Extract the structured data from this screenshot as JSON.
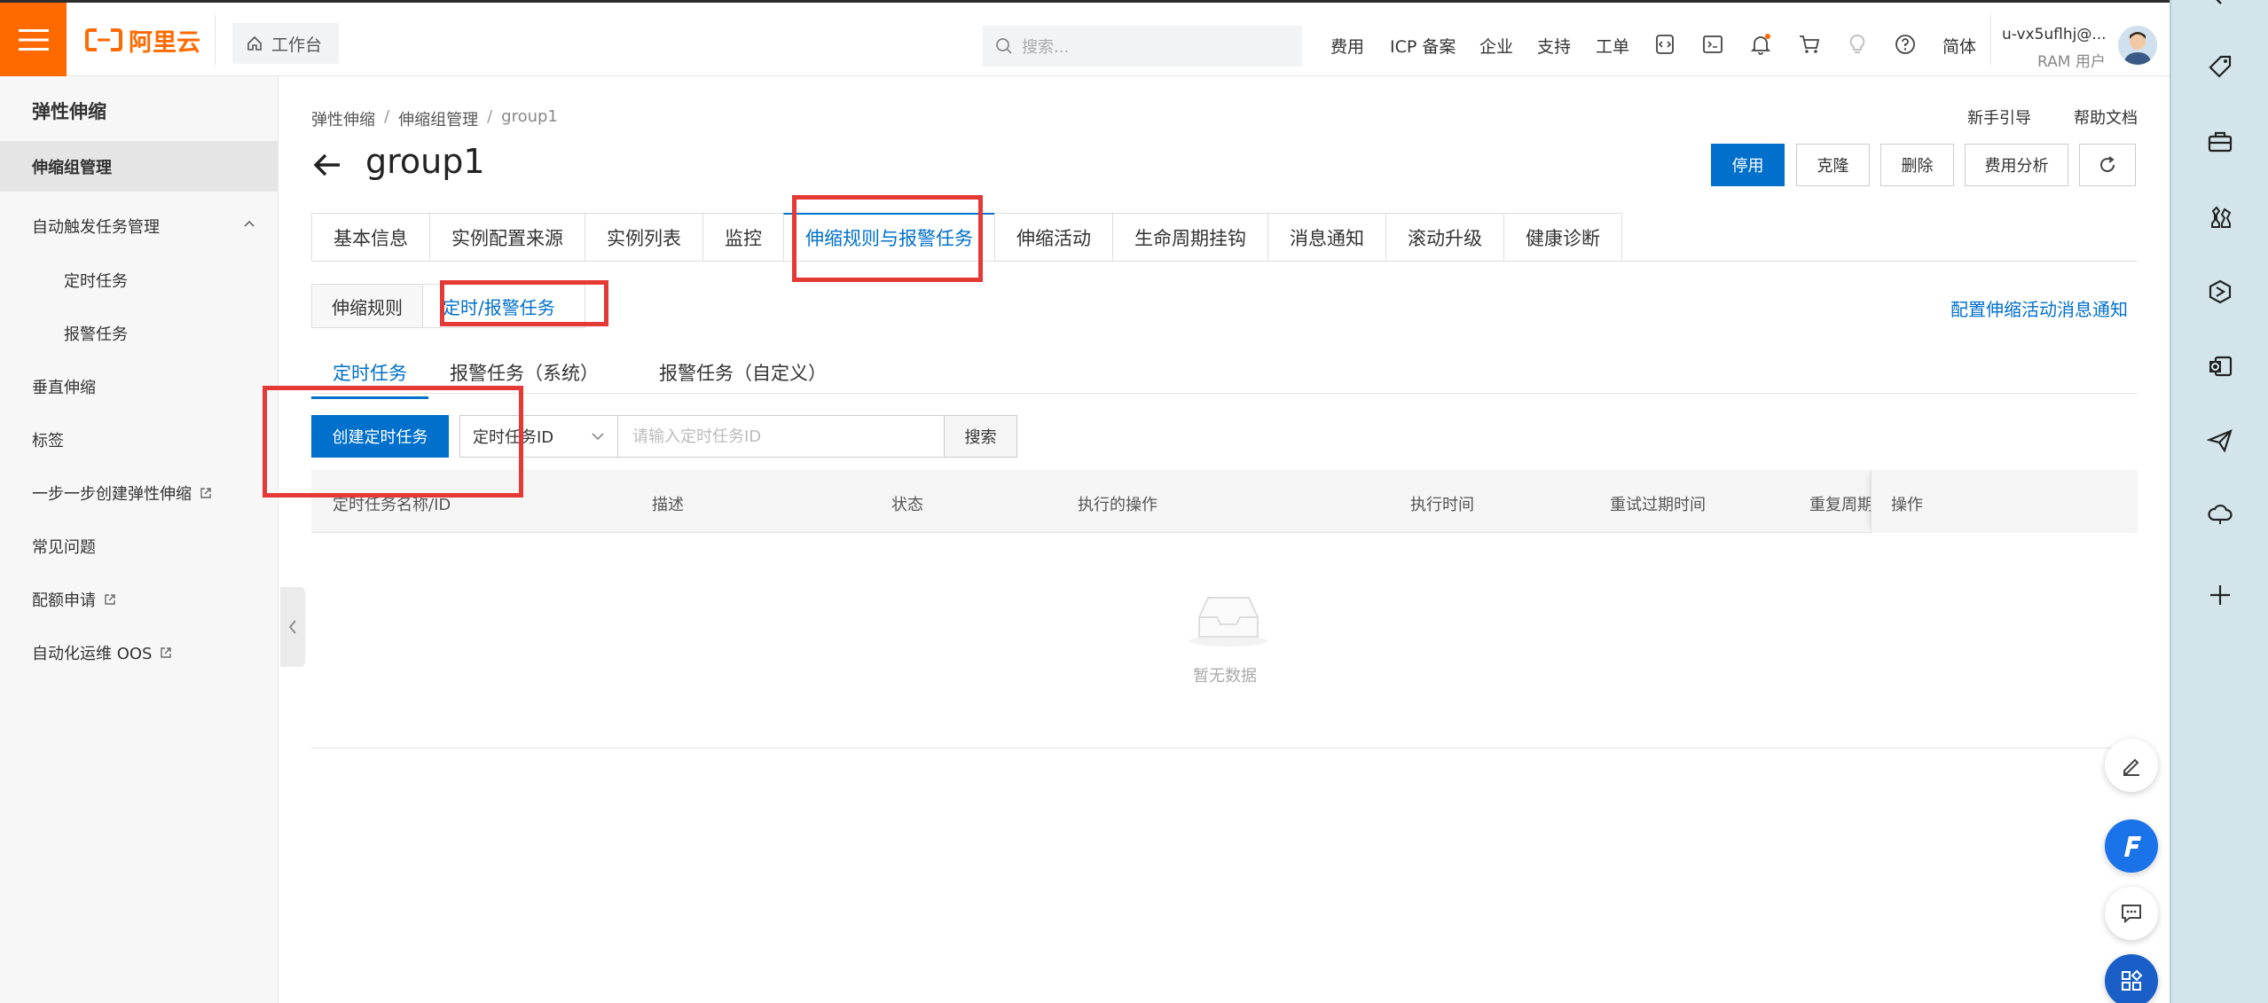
{
  "topbar": {
    "logo_text": "阿里云",
    "workbench": "工作台",
    "search_placeholder": "搜索...",
    "links": [
      "费用",
      "ICP 备案",
      "企业",
      "支持",
      "工单"
    ],
    "lang": "简体",
    "user_name": "u-vx5uflhj@...",
    "user_role": "RAM 用户"
  },
  "sidebar": {
    "title": "弹性伸缩",
    "items": [
      {
        "label": "伸缩组管理"
      },
      {
        "label": "自动触发任务管理"
      },
      {
        "label": "定时任务"
      },
      {
        "label": "报警任务"
      },
      {
        "label": "垂直伸缩"
      },
      {
        "label": "标签"
      },
      {
        "label": "一步一步创建弹性伸缩"
      },
      {
        "label": "常见问题"
      },
      {
        "label": "配额申请"
      },
      {
        "label": "自动化运维 OOS"
      }
    ]
  },
  "breadcrumb": [
    "弹性伸缩",
    "伸缩组管理",
    "group1"
  ],
  "header_links": {
    "guide": "新手引导",
    "docs": "帮助文档"
  },
  "page_title": "group1",
  "header_buttons": {
    "stop": "停用",
    "clone": "克隆",
    "delete": "删除",
    "cost": "费用分析"
  },
  "tabs": [
    "基本信息",
    "实例配置来源",
    "实例列表",
    "监控",
    "伸缩规则与报警任务",
    "伸缩活动",
    "生命周期挂钩",
    "消息通知",
    "滚动升级",
    "健康诊断"
  ],
  "active_tab": "伸缩规则与报警任务",
  "subtabs": [
    "伸缩规则",
    "定时/报警任务"
  ],
  "config_link": "配置伸缩活动消息通知",
  "subtabs2": [
    "定时任务",
    "报警任务（系统）",
    "报警任务（自定义）"
  ],
  "toolbar": {
    "create_label": "创建定时任务",
    "select_value": "定时任务ID",
    "input_placeholder": "请输入定时任务ID",
    "search_label": "搜索"
  },
  "table": {
    "columns": [
      "定时任务名称/ID",
      "描述",
      "状态",
      "执行的操作",
      "执行时间",
      "重试过期时间",
      "重复周期",
      "操作"
    ],
    "empty_text": "暂无数据"
  },
  "colors": {
    "accent": "#0070cc",
    "brand": "#ff6a00",
    "highlight": "#e53935"
  }
}
